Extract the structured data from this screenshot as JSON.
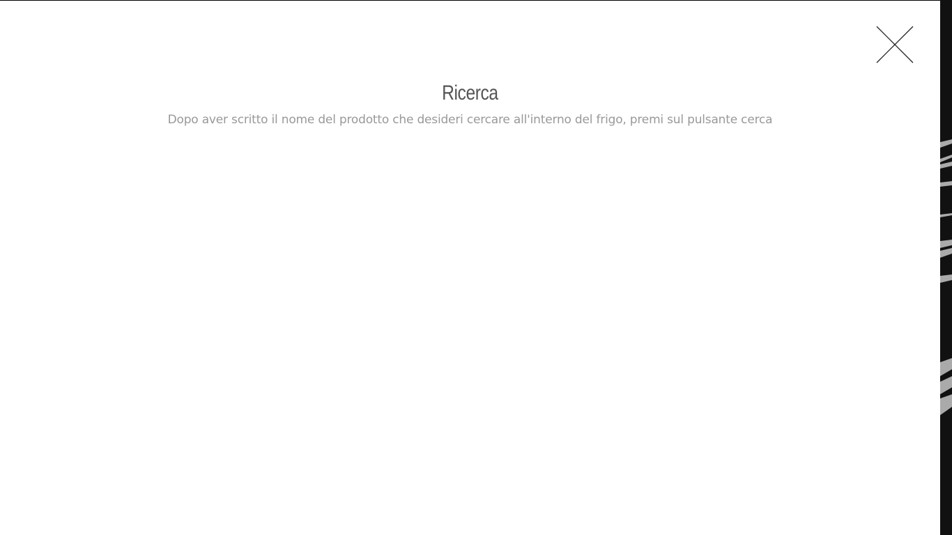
{
  "search_overlay": {
    "title": "Ricerca",
    "description": "Dopo aver scritto il nome del prodotto che desideri cercare all'interno del frigo, premi sul pulsante cerca",
    "close_icon": "close-icon"
  }
}
